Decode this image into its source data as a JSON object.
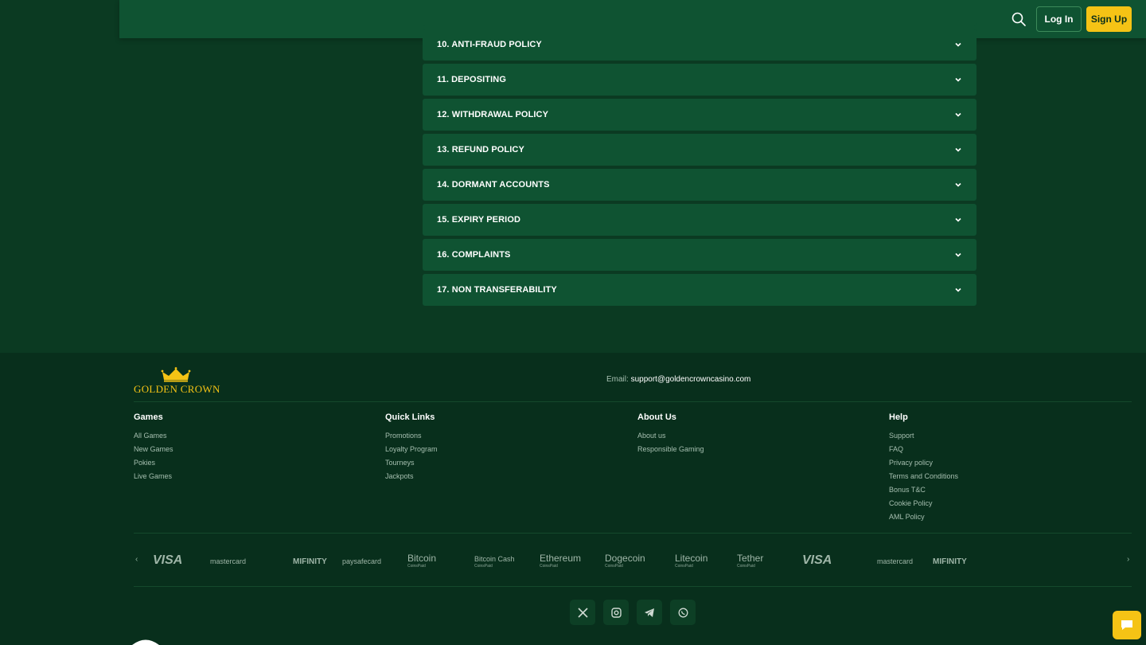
{
  "header": {
    "search_icon": "search-icon",
    "login_label": "Log In",
    "signup_label": "Sign Up"
  },
  "accordion": {
    "items": [
      {
        "label": "10. ANTI-FRAUD POLICY"
      },
      {
        "label": "11. DEPOSITING"
      },
      {
        "label": "12. WITHDRAWAL POLICY"
      },
      {
        "label": "13. REFUND POLICY"
      },
      {
        "label": "14. DORMANT ACCOUNTS"
      },
      {
        "label": "15. EXPIRY PERIOD"
      },
      {
        "label": "16. COMPLAINTS"
      },
      {
        "label": "17. NON TRANSFERABILITY"
      }
    ]
  },
  "footer": {
    "logo_text": "GOLDEN CROWN",
    "email_label": "Email:",
    "email_address": "support@goldencrowncasino.com",
    "columns": [
      {
        "title": "Games",
        "links": [
          "All Games",
          "New Games",
          "Pokies",
          "Live Games"
        ]
      },
      {
        "title": "Quick Links",
        "links": [
          "Promotions",
          "Loyalty Program",
          "Tourneys",
          "Jackpots"
        ]
      },
      {
        "title": "About Us",
        "links": [
          "About us",
          "Responsible Gaming"
        ]
      },
      {
        "title": "Help",
        "links": [
          "Support",
          "FAQ",
          "Privacy policy",
          "Terms and Conditions",
          "Bonus T&C",
          "Cookie Policy",
          "AML Policy"
        ]
      }
    ],
    "payments": [
      "VISA",
      "mastercard",
      "MIFINITY",
      "paysafecard",
      "Bitcoin",
      "Bitcoin Cash",
      "Ethereum",
      "Dogecoin",
      "Litecoin",
      "Tether",
      "VISA",
      "mastercard",
      "MIFINITY"
    ],
    "payments_sub": "CoinsPaid",
    "socials": [
      "x-icon",
      "instagram-icon",
      "telegram-icon",
      "whatsapp-icon"
    ]
  },
  "colors": {
    "background": "#0b3a22",
    "panel": "#0f5332",
    "footer": "#082f1c",
    "accent": "#f5c315"
  }
}
